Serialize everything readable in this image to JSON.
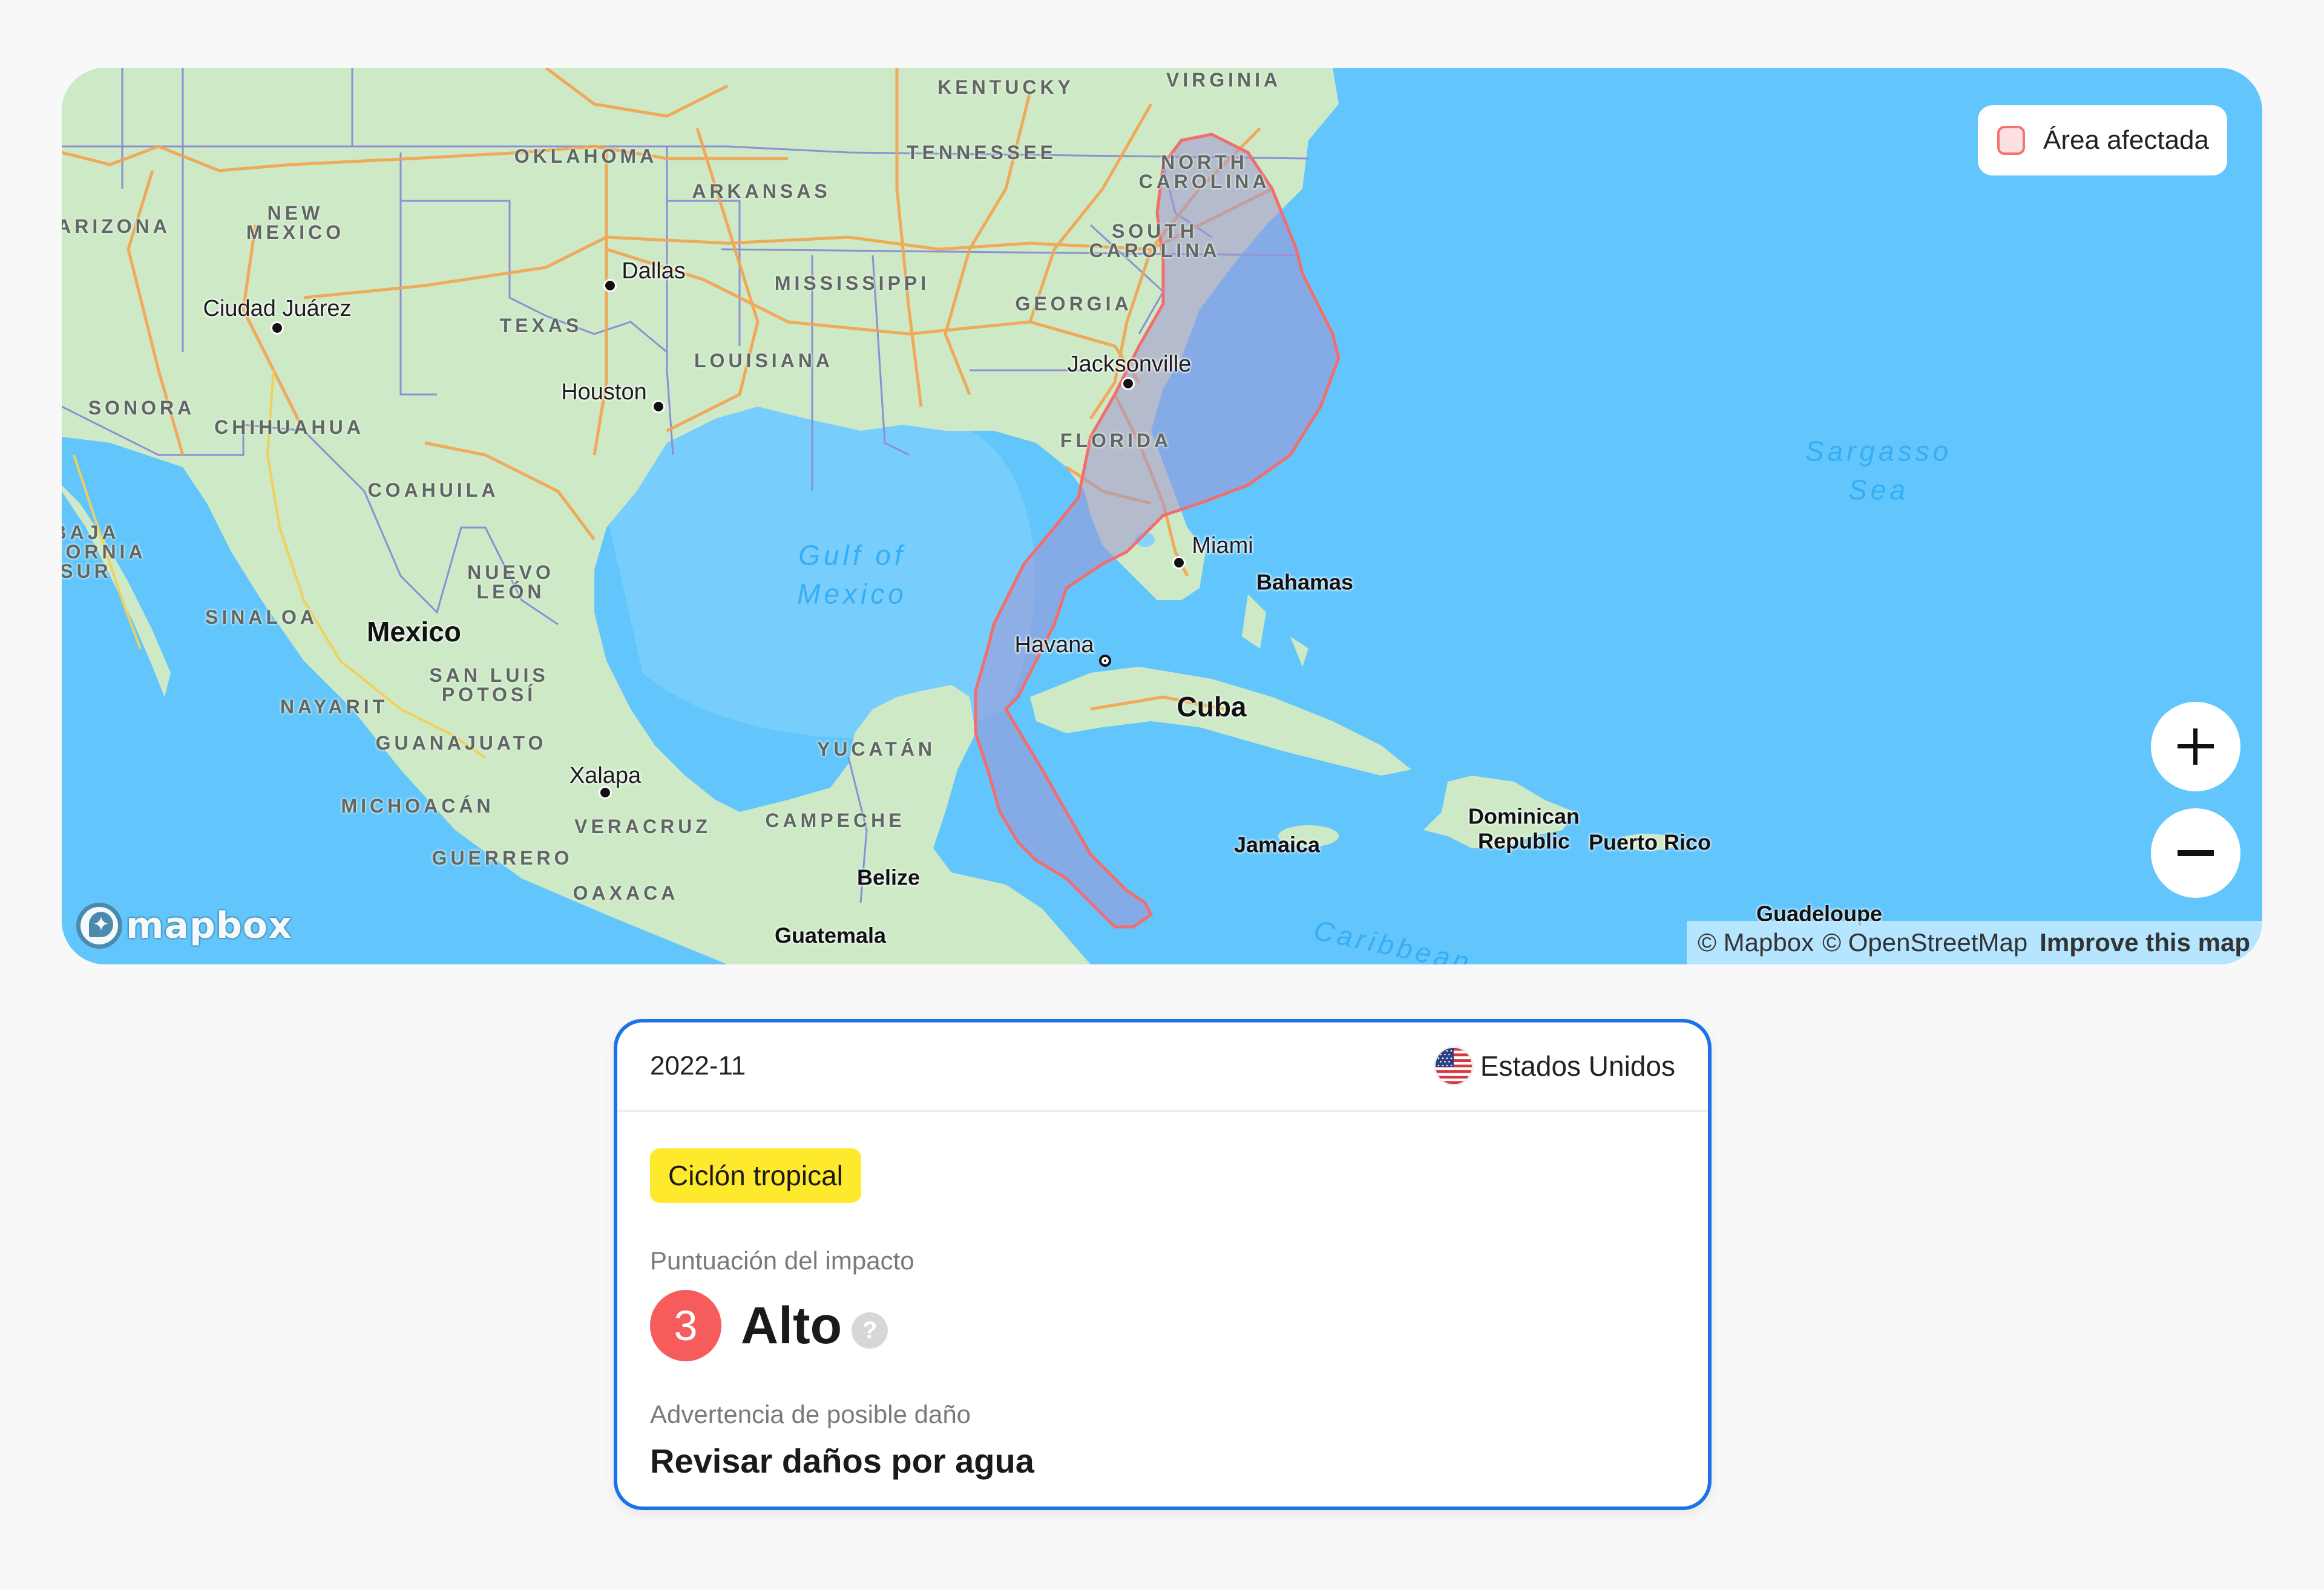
{
  "map": {
    "legend": {
      "label": "Área afectada",
      "fill_color": "#fde0e0",
      "stroke_color": "#f47171"
    },
    "zoom_in_label": "+",
    "zoom_out_label": "−",
    "logo_text": "mapbox",
    "attribution": {
      "mapbox": "© Mapbox",
      "osm": "© OpenStreetMap",
      "improve": "Improve this map"
    },
    "affected_area_color": "#f26d6d",
    "labels": {
      "states": {
        "kentucky": "KENTUCKY",
        "virginia": "VIRGINIA",
        "oklahoma": "OKLAHOMA",
        "tennessee": "TENNESSEE",
        "arkansas": "ARKANSAS",
        "north_carolina": "NORTH\nCAROLINA",
        "arizona": "ARIZONA",
        "new_mexico": "NEW\nMEXICO",
        "south_carolina": "SOUTH\nCAROLINA",
        "mississippi": "MISSISSIPPI",
        "georgia": "GEORGIA",
        "texas": "TEXAS",
        "louisiana": "LOUISIANA",
        "sonora": "SONORA",
        "chihuahua": "CHIHUAHUA",
        "florida": "FLORIDA",
        "coahuila": "COAHUILA",
        "baja_california_sur": "BAJA\nLIFORNIA\nSUR",
        "nuevo_leon": "NUEVO\nLEÓN",
        "sinaloa": "SINALOA",
        "san_luis_potosi": "SAN LUIS\nPOTOSÍ",
        "nayarit": "NAYARIT",
        "guanajuato": "GUANAJUATO",
        "yucatan": "YUCATÁN",
        "michoacan": "MICHOACÁN",
        "veracruz": "VERACRUZ",
        "campeche": "CAMPECHE",
        "guerrero": "GUERRERO",
        "oaxaca": "OAXACA"
      },
      "cities": {
        "dallas": "Dallas",
        "ciudad_juarez": "Ciudad Juárez",
        "jacksonville": "Jacksonville",
        "houston": "Houston",
        "miami": "Miami",
        "havana": "Havana",
        "xalapa": "Xalapa"
      },
      "countries": {
        "mexico": "Mexico",
        "cuba": "Cuba",
        "belize": "Belize",
        "guatemala": "Guatemala"
      },
      "islands": {
        "bahamas": "Bahamas",
        "jamaica": "Jamaica",
        "dominican_republic": "Dominican\nRepublic",
        "puerto_rico": "Puerto Rico",
        "guadeloupe": "Guadeloupe"
      },
      "water": {
        "gulf_of_mexico": "Gulf of\nMexico",
        "sargasso_sea": "Sargasso\nSea",
        "caribbean": "Caribbean"
      }
    }
  },
  "card": {
    "date": "2022-11",
    "country": "Estados Unidos",
    "flag": "us-flag",
    "event_type": "Ciclón tropical",
    "event_type_color": "#ffe92d",
    "impact_label": "Puntuación del impacto",
    "impact_score": "3",
    "impact_level": "Alto",
    "impact_color": "#f75c5c",
    "help_label": "?",
    "warning_label": "Advertencia de posible daño",
    "warning_value": "Revisar daños por agua",
    "border_color": "#1a73e8"
  }
}
